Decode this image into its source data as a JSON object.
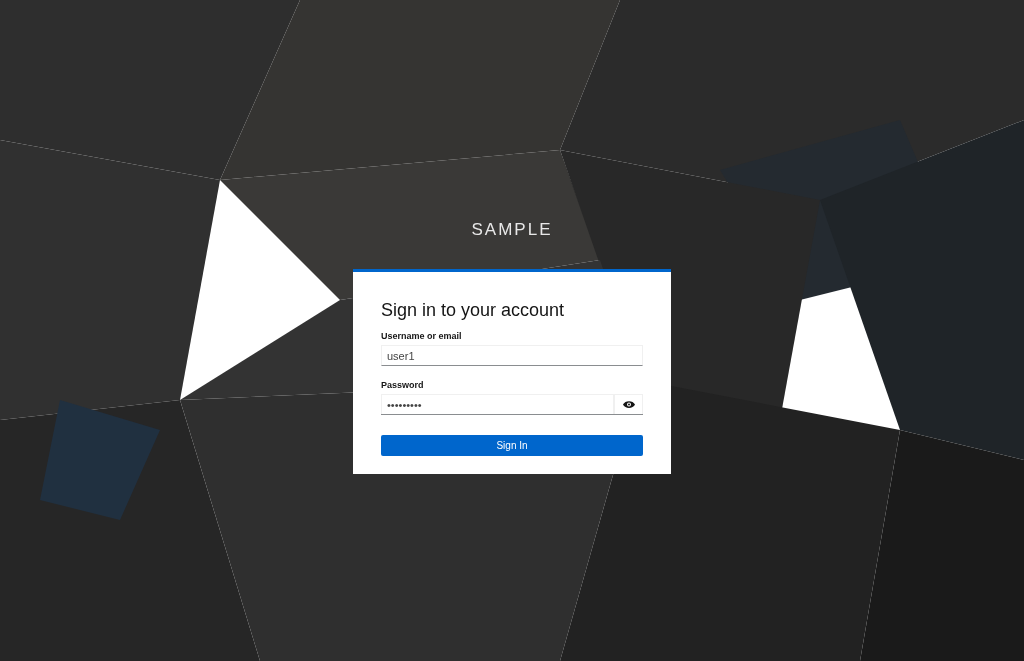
{
  "brand": "SAMPLE",
  "card": {
    "title": "Sign in to your account",
    "fields": [
      {
        "label": "Username or email",
        "value": "user1",
        "kind": "text"
      },
      {
        "label": "Password",
        "value": "•••••••••",
        "kind": "password"
      }
    ],
    "button": "Sign In"
  }
}
